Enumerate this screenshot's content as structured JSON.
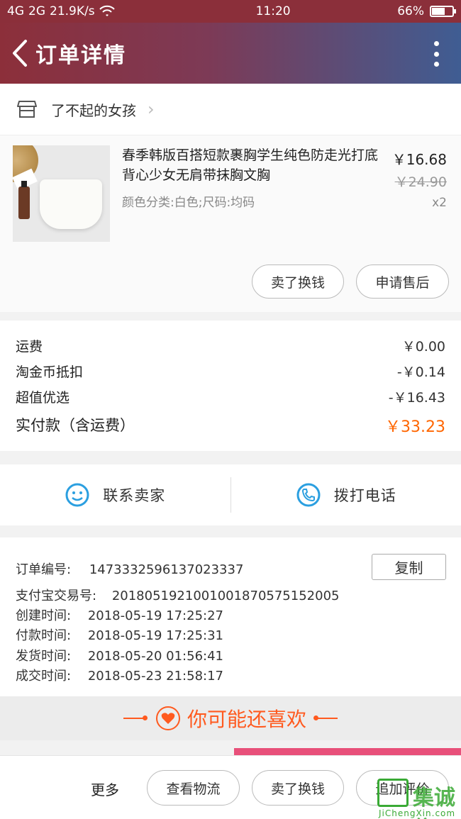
{
  "status_bar": {
    "signal": "4G",
    "signal2": "2G",
    "net_speed": "21.9K/s",
    "time": "11:20",
    "battery": "66%",
    "battery_level": 0.66
  },
  "header": {
    "title": "订单详情"
  },
  "shop": {
    "name": "了不起的女孩"
  },
  "product": {
    "title": "春季韩版百搭短款裹胸学生纯色防走光打底背心少女无肩带抹胸文胸",
    "spec": "颜色分类:白色;尺码:均码",
    "price": "￥16.68",
    "original_price": "￥24.90",
    "quantity": "x2",
    "sell_button": "卖了换钱",
    "after_sale_button": "申请售后"
  },
  "costs": {
    "shipping_label": "运费",
    "shipping_value": "￥0.00",
    "coin_label": "淘金币抵扣",
    "coin_value": "-￥0.14",
    "deal_label": "超值优选",
    "deal_value": "-￥16.43",
    "total_label": "实付款（含运费）",
    "total_value": "￥33.23"
  },
  "contact": {
    "seller_label": "联系卖家",
    "phone_label": "拨打电话"
  },
  "order_info": {
    "order_no_label": "订单编号:",
    "order_no": "1473332596137023337",
    "copy_button": "复制",
    "alipay_label": "支付宝交易号:",
    "alipay_no": "2018051921001001870575152005",
    "created_label": "创建时间:",
    "created_time": "2018-05-19 17:25:27",
    "paid_label": "付款时间:",
    "paid_time": "2018-05-19 17:25:31",
    "shipped_label": "发货时间:",
    "shipped_time": "2018-05-20 01:56:41",
    "completed_label": "成交时间:",
    "completed_time": "2018-05-23 21:58:17"
  },
  "recommend": {
    "title": "你可能还喜欢"
  },
  "bottom_bar": {
    "more": "更多",
    "logistics_button": "查看物流",
    "sell_button": "卖了换钱",
    "review_button": "追加评价"
  },
  "watermark": {
    "text": "集诚信",
    "site": "JiChengXin.com"
  },
  "colors": {
    "accent_orange": "#ff6600",
    "recommend_orange": "#ff5a1f",
    "icon_blue": "#2b9fe0"
  }
}
